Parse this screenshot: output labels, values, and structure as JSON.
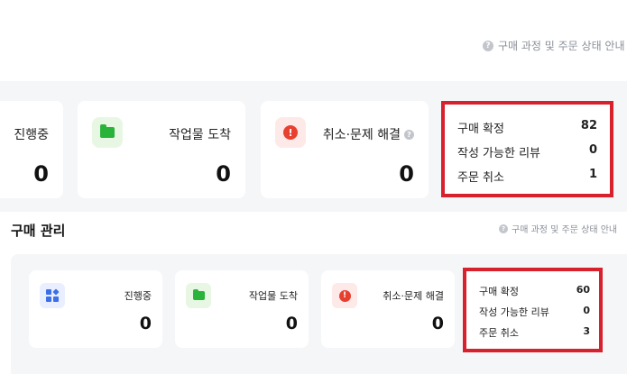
{
  "top": {
    "guide_text": "구매 과정 및 주문 상태 안내",
    "guide_icon": "question-icon",
    "cards": [
      {
        "label": "진행중",
        "value": "0"
      },
      {
        "label": "작업물 도착",
        "value": "0",
        "icon": "folder-icon"
      },
      {
        "label": "취소·문제 해결",
        "value": "0",
        "icon": "alert-icon"
      }
    ],
    "summary": [
      {
        "label": "구매 확정",
        "value": "82"
      },
      {
        "label": "작성 가능한 리뷰",
        "value": "0"
      },
      {
        "label": "주문 취소",
        "value": "1"
      }
    ]
  },
  "purchase": {
    "title": "구매 관리",
    "guide_text": "구매 과정 및 주문 상태 안내",
    "cards": [
      {
        "label": "진행중",
        "value": "0",
        "icon": "grid-icon"
      },
      {
        "label": "작업물 도착",
        "value": "0",
        "icon": "folder-icon"
      },
      {
        "label": "취소·문제 해결",
        "value": "0",
        "icon": "alert-icon"
      }
    ],
    "summary": [
      {
        "label": "구매 확정",
        "value": "60"
      },
      {
        "label": "작성 가능한 리뷰",
        "value": "0"
      },
      {
        "label": "주문 취소",
        "value": "3"
      }
    ]
  },
  "colors": {
    "highlight_border": "#d7212d",
    "panel_bg": "#f5f6f8",
    "green": "#29b33a",
    "red": "#e8402f",
    "blue": "#3d6fe8"
  }
}
